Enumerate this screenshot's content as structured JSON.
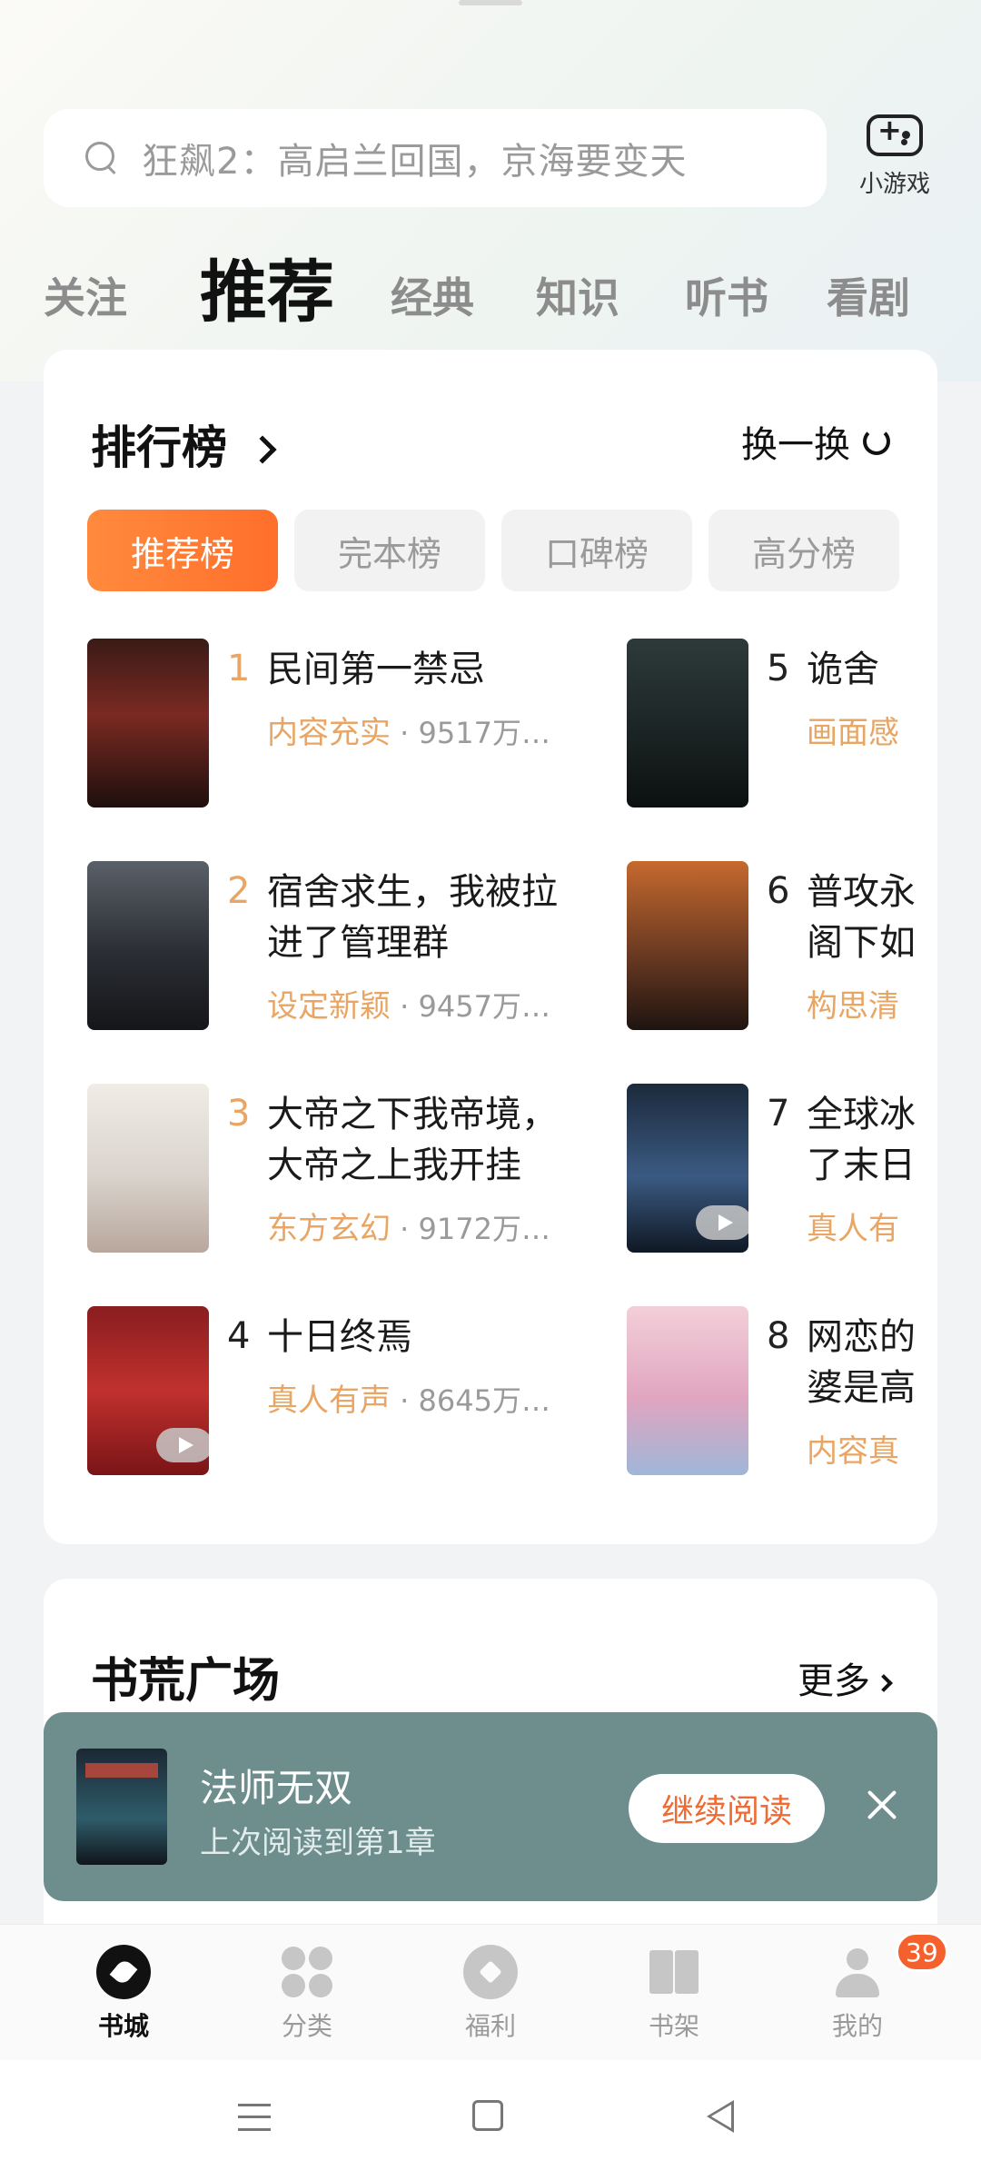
{
  "search": {
    "placeholder": "狂飙2：高启兰回国，京海要变天"
  },
  "mini_game": {
    "label": "小游戏",
    "icon": "gamepad-icon"
  },
  "tabs": [
    "关注",
    "推荐",
    "经典",
    "知识",
    "听书",
    "看剧"
  ],
  "active_tab": "推荐",
  "ranking": {
    "title": "排行榜",
    "swap_label": "换一换",
    "chips": [
      "推荐榜",
      "完本榜",
      "口碑榜",
      "高分榜"
    ],
    "active_chip": "推荐榜",
    "books": [
      {
        "rank": "1",
        "title": "民间第一禁忌",
        "tag": "内容充实",
        "num": "9517万…"
      },
      {
        "rank": "2",
        "title": "宿舍求生，我被拉进了管理群",
        "tag": "设定新颖",
        "num": "9457万…"
      },
      {
        "rank": "3",
        "title": "大帝之下我帝境，大帝之上我开挂",
        "tag": "东方玄幻",
        "num": "9172万…"
      },
      {
        "rank": "4",
        "title": "十日终焉",
        "tag": "真人有声",
        "num": "8645万…"
      },
      {
        "rank": "5",
        "title": "诡舍",
        "tag": "画面感",
        "num": ""
      },
      {
        "rank": "6",
        "title": "普攻永阁下如",
        "tag": "构思清",
        "num": ""
      },
      {
        "rank": "7",
        "title": "全球冰了末日",
        "tag": "真人有",
        "num": ""
      },
      {
        "rank": "8",
        "title": "网恋的婆是高",
        "tag": "内容真",
        "num": ""
      }
    ]
  },
  "square": {
    "title": "书荒广场",
    "more_label": "更多"
  },
  "continue_reading": {
    "title": "法师无双",
    "subtitle": "上次阅读到第1章",
    "button": "继续阅读"
  },
  "bottom_nav": {
    "items": [
      "书城",
      "分类",
      "福利",
      "书架",
      "我的"
    ],
    "active": "书城",
    "badge": "39"
  },
  "colors": {
    "accent": "#ff7a33",
    "tag": "#e8a563",
    "banner": "#6e8d8d"
  }
}
